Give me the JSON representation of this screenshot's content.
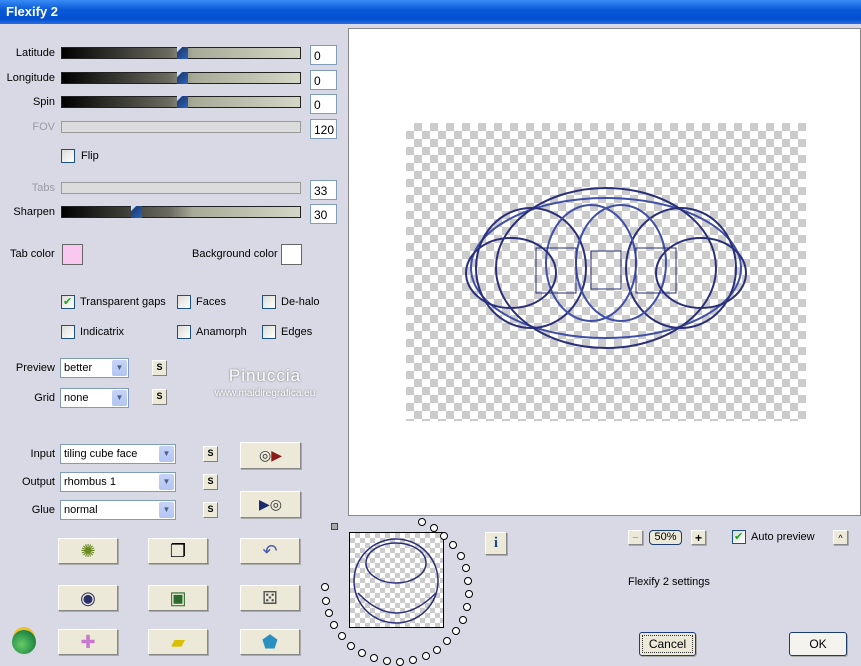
{
  "window": {
    "title": "Flexify 2"
  },
  "sliders": [
    {
      "label": "Latitude",
      "value": "0",
      "level": 0.5,
      "enabled": true
    },
    {
      "label": "Longitude",
      "value": "0",
      "level": 0.5,
      "enabled": true
    },
    {
      "label": "Spin",
      "value": "0",
      "level": 0.5,
      "enabled": true
    },
    {
      "label": "FOV",
      "value": "120",
      "enabled": false
    },
    {
      "label": "Tabs",
      "value": "33",
      "enabled": false
    },
    {
      "label": "Sharpen",
      "value": "30",
      "level": 0.3,
      "enabled": true
    }
  ],
  "flip": {
    "label": "Flip",
    "checked": false
  },
  "colors": {
    "tab_label": "Tab color",
    "tab_color": "#f8c8f0",
    "bg_label": "Background color",
    "bg_color": "#ffffff"
  },
  "options": [
    {
      "label": "Transparent gaps",
      "checked": true
    },
    {
      "label": "Faces",
      "checked": false
    },
    {
      "label": "De-halo",
      "checked": false
    },
    {
      "label": "Indicatrix",
      "checked": false
    },
    {
      "label": "Anamorph",
      "checked": false
    },
    {
      "label": "Edges",
      "checked": false
    }
  ],
  "preview": {
    "label": "Preview",
    "value": "better"
  },
  "grid": {
    "label": "Grid",
    "value": "none"
  },
  "s_label": "S",
  "watermark": {
    "name": "Pinuccia",
    "url": "www.maidiregrafica.eu"
  },
  "io": [
    {
      "label": "Input",
      "value": "tiling cube face"
    },
    {
      "label": "Output",
      "value": "rhombus 1"
    },
    {
      "label": "Glue",
      "value": "normal"
    }
  ],
  "zoom": {
    "minus": "−",
    "value": "50%",
    "plus": "+"
  },
  "auto_preview": {
    "label": "Auto preview",
    "checked": true
  },
  "collapse": "^",
  "settings_text": "Flexify 2 settings",
  "info": "i",
  "cancel": "Cancel",
  "ok": "OK"
}
